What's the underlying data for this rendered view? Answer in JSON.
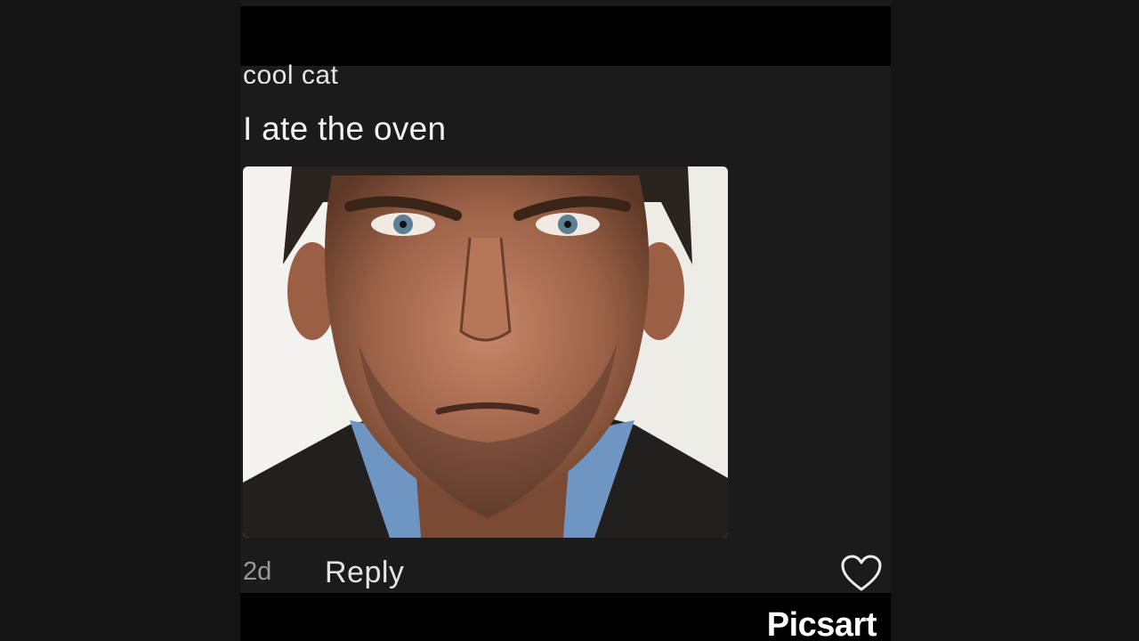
{
  "comment": {
    "username": "cool cat",
    "text": "I ate the oven",
    "time": "2d",
    "reply_label": "Reply"
  },
  "icons": {
    "like": "heart-outline-icon"
  },
  "watermark": {
    "text": "Picsart"
  },
  "colors": {
    "background": "#141414",
    "card": "#1b1b1b",
    "bars": "#000000",
    "text_primary": "#f2f2f2",
    "text_secondary": "#9a9a9a"
  }
}
